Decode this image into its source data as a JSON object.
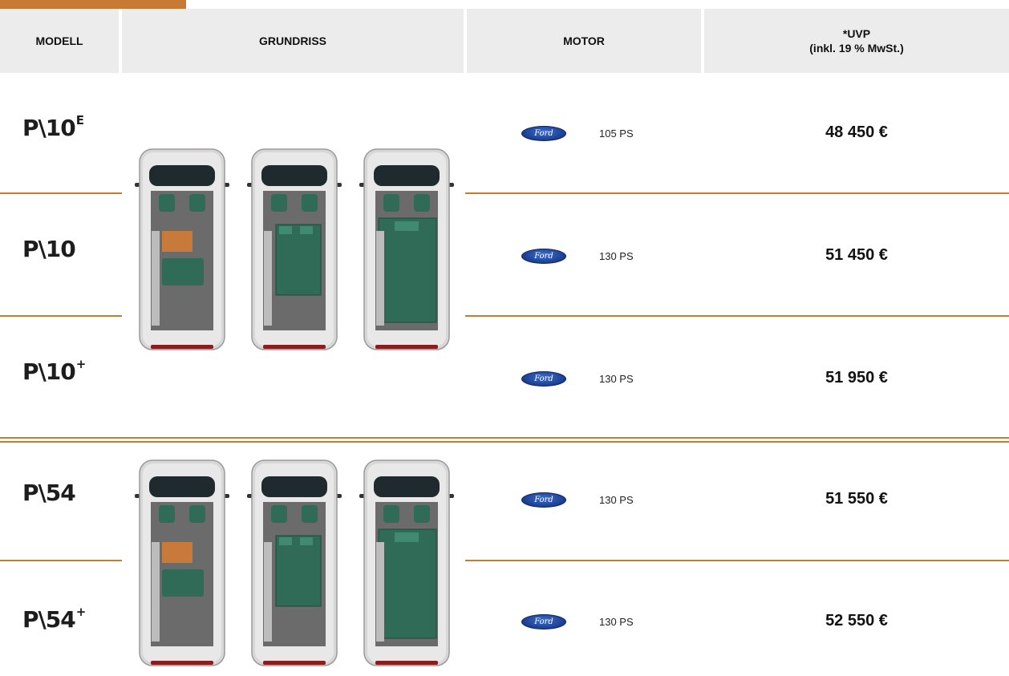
{
  "header": {
    "model": "MODELL",
    "floorplan": "GRUNDRISS",
    "motor": "MOTOR",
    "price": "*UVP\n(inkl. 19 % MwSt.)"
  },
  "rows": [
    {
      "model": "P\\10",
      "sup": "E",
      "ford": "Ford",
      "power": "105 PS",
      "price": "48 450 €"
    },
    {
      "model": "P\\10",
      "sup": "",
      "ford": "Ford",
      "power": "130 PS",
      "price": "51 450 €"
    },
    {
      "model": "P\\10",
      "sup": "+",
      "ford": "Ford",
      "power": "130 PS",
      "price": "51 950 €"
    },
    {
      "model": "P\\54",
      "sup": "",
      "ford": "Ford",
      "power": "130 PS",
      "price": "51 550 €"
    },
    {
      "model": "P\\54",
      "sup": "+",
      "ford": "Ford",
      "power": "130 PS",
      "price": "52 550 €"
    }
  ],
  "colors": {
    "accent": "#c77a33",
    "header_bg": "#ececec",
    "interior": "#2f6b57",
    "table": "#c77a3a"
  }
}
